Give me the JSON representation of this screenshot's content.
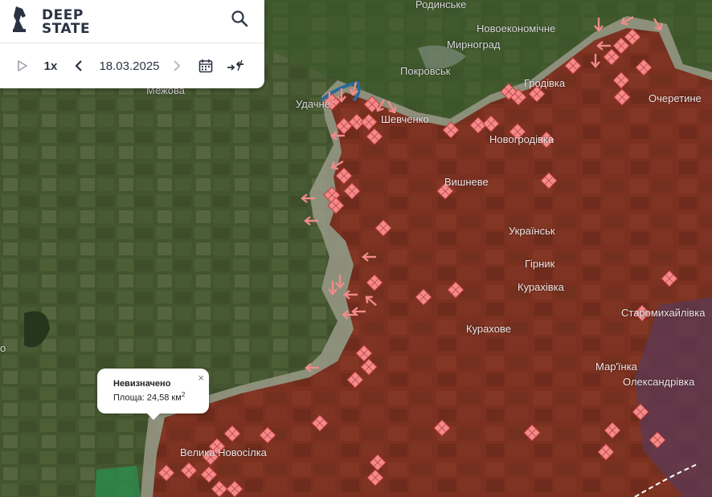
{
  "app": {
    "logo_line1": "DEEP",
    "logo_line2": "STATE"
  },
  "toolbar": {
    "speed": "1x",
    "date": "18.03.2025",
    "icons": [
      "play-icon",
      "chevron-left-icon",
      "chevron-right-icon",
      "calendar-icon",
      "compare-arrows-icon",
      "search-icon"
    ]
  },
  "colors": {
    "occupied": "#7a2f1e",
    "contested": "#9a9a88",
    "liberated_green": "#2e8a4a",
    "marker": "#f28b8b",
    "dnr_zone": "#5a3a5a",
    "water": "#2a6a9a"
  },
  "places": {
    "rodynske": "Родинське",
    "novoekonomichne": "Новоекономічне",
    "myrnohrad": "Мирноград",
    "pokrovsk": "Покровськ",
    "hrodivka": "Гродівка",
    "ocheretyne": "Очеретине",
    "mezhova": "Межова",
    "udachne": "Удачне",
    "shevchenko": "Шевченко",
    "novohrodivka": "Новогродівка",
    "vyshneve": "Вишневе",
    "ukrainsk": "Українськ",
    "hirnyk": "Гірник",
    "kurakhivka": "Курахівка",
    "kurakhove": "Курахове",
    "staromykhailivka": "Старомихайлівка",
    "marinka": "Мар'їнка",
    "oleksandrivka": "Олександрівка",
    "velyka_novosilka": "Велика Новосілка",
    "edge_letter": "о"
  },
  "popup": {
    "title": "Невизначено",
    "area": "Площа: 24,58 км",
    "area_sup": "2",
    "close": "×"
  }
}
